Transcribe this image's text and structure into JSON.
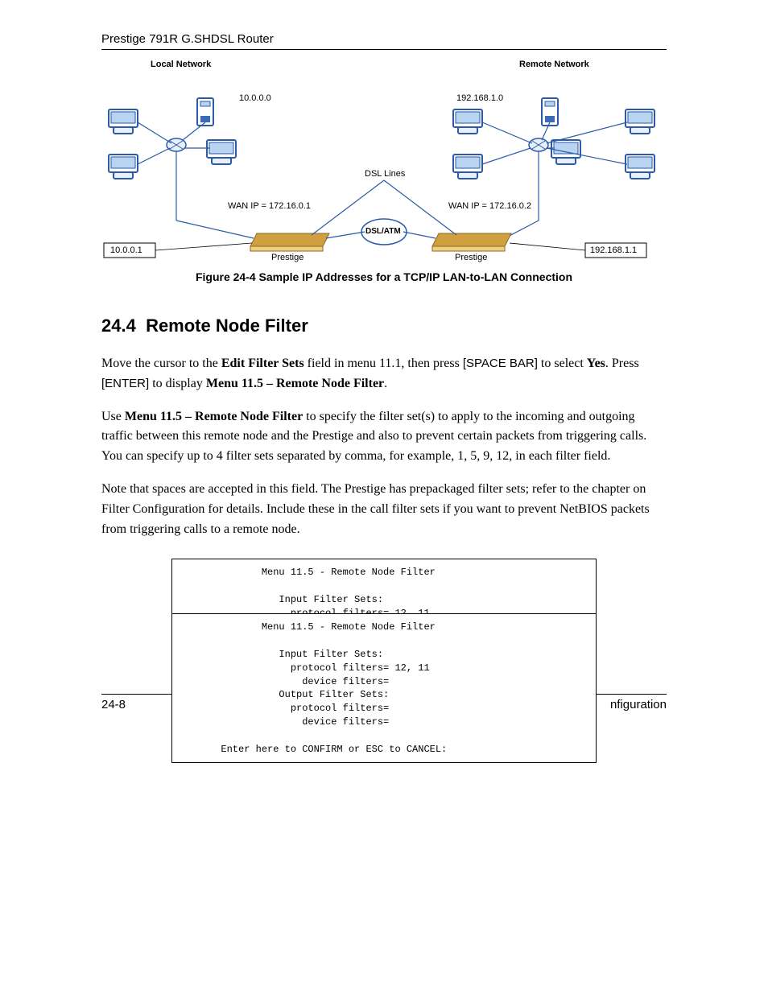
{
  "header": {
    "title": "Prestige 791R G.SHDSL Router"
  },
  "diagram": {
    "local_network_label": "Local Network",
    "remote_network_label": "Remote Network",
    "local_subnet": "10.0.0.0",
    "remote_subnet": "192.168.1.0",
    "dsl_lines_label": "DSL Lines",
    "wan_ip_left": "WAN IP = 172.16.0.1",
    "wan_ip_right": "WAN IP = 172.16.0.2",
    "dsl_atm_label": "DSL/ATM",
    "local_router_ip": "10.0.0.1",
    "remote_router_ip": "192.168.1.1",
    "router_left_label": "Prestige",
    "router_right_label": "Prestige"
  },
  "caption": "Figure 24-4 Sample IP Addresses for a TCP/IP LAN-to-LAN Connection",
  "section": {
    "number": "24.4",
    "title": "Remote Node Filter"
  },
  "p1": {
    "t1": "Move the cursor to the ",
    "b1": "Edit Filter Sets",
    "t2": " field in menu 11.1, then press ",
    "s1": "[SPACE BAR]",
    "t3": " to select ",
    "b2": "Yes",
    "t4": ". Press ",
    "s2": "[ENTER]",
    "t5": " to display ",
    "b3": "Menu 11.5 – Remote Node Filter",
    "t6": "."
  },
  "p2": {
    "t1": "Use ",
    "b1": "Menu 11.5 – Remote Node Filter",
    "t2": " to specify the filter set(s) to apply to the incoming and outgoing traffic between this remote node and the Prestige and also to prevent certain packets from triggering calls. You can specify up to 4 filter sets separated by comma, for example, 1, 5, 9, 12, in each filter field."
  },
  "p3": {
    "t1": "Note that spaces are accepted in this field. The Prestige has prepackaged filter sets; refer to the chapter on Filter Configuration for details. Include these in the call filter sets if you want to prevent NetBIOS packets from triggering calls to a remote node."
  },
  "codebox_back": "              Menu 11.5 - Remote Node Filter\n\n                 Input Filter Sets:\n                   protocol filters= 12, 11\n                     device filters=",
  "codebox_front": "              Menu 11.5 - Remote Node Filter\n\n                 Input Filter Sets:\n                   protocol filters= 12, 11\n                     device filters=\n                 Output Filter Sets:\n                   protocol filters=\n                     device filters=\n\n       Enter here to CONFIRM or ESC to CANCEL:",
  "footer": {
    "page_num": "24-8",
    "right_text": "nfiguration"
  }
}
